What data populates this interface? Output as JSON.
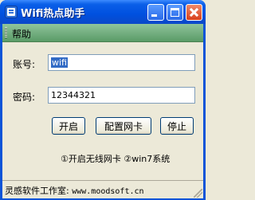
{
  "window": {
    "title": "Wifi热点助手",
    "icon": "app-icon",
    "controls": [
      "minimize-icon",
      "maximize-icon",
      "close-icon"
    ]
  },
  "menu": {
    "help_label": "帮助"
  },
  "form": {
    "account_label": "账号:",
    "account_value": "wifi",
    "password_label": "密码:",
    "password_value": "12344321"
  },
  "buttons": {
    "start": "开启",
    "configure_nic": "配置网卡",
    "stop": "停止"
  },
  "hint": "①开启无线网卡 ②win7系统",
  "status": {
    "company": "灵感软件工作室:",
    "url": "www.moodsoft.cn"
  }
}
